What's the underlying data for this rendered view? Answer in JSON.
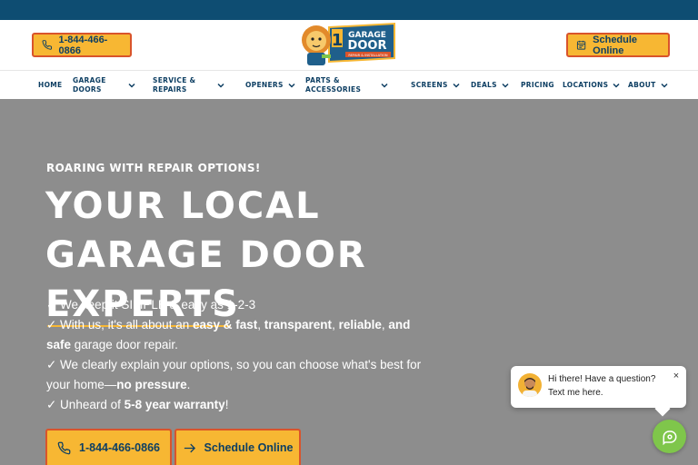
{
  "header": {
    "phone_label": "1-844-466-0866",
    "schedule_label": "Schedule Online",
    "logo": {
      "line1": "GARAGE",
      "line2": "DOOR",
      "line3": "REPAIR & INSTALLATION",
      "number": "1"
    }
  },
  "nav": {
    "items": [
      {
        "label": "Home",
        "dropdown": false
      },
      {
        "label": "Garage Doors",
        "dropdown": true
      },
      {
        "label": "Service & Repairs",
        "dropdown": true
      },
      {
        "label": "Openers",
        "dropdown": true
      },
      {
        "label": "Parts & Accessories",
        "dropdown": true
      },
      {
        "label": "Screens",
        "dropdown": true
      },
      {
        "label": "Deals",
        "dropdown": true
      },
      {
        "label": "Pricing",
        "dropdown": false
      },
      {
        "label": "Locations",
        "dropdown": true
      },
      {
        "label": "About",
        "dropdown": true
      }
    ]
  },
  "hero": {
    "eyebrow": "Roaring with Repair Options!",
    "headline_part1": "Your Local Garage Door",
    "headline_highlight": "Experts",
    "bullets": [
      {
        "pre": "✓ We keep it SIMPLE & easy as 1-2-3"
      },
      {
        "pre": "✓ With us, it's all about an ",
        "b1": "easy & fast",
        "mid1": ", ",
        "b2": "transparent",
        "mid2": ", ",
        "b3": "reliable",
        "mid3": ", ",
        "b4": "and safe",
        "post": " garage door repair."
      },
      {
        "pre": "✓ We clearly explain your options, so you can choose what's best for your home—",
        "b1": "no pressure",
        "post": "."
      },
      {
        "pre": "✓ Unheard of ",
        "b1": "5-8 year warranty",
        "post": "!"
      }
    ],
    "phone_button": "1-844-466-0866",
    "schedule_button": "Schedule Online"
  },
  "chat": {
    "message": "Hi there! Have a question? Text me here.",
    "close": "×"
  },
  "colors": {
    "topbar": "#0e4d72",
    "accent": "#f7b733",
    "accent_border": "#d9542b",
    "navy": "#0e3f63",
    "chat_green": "#7fc64b"
  }
}
